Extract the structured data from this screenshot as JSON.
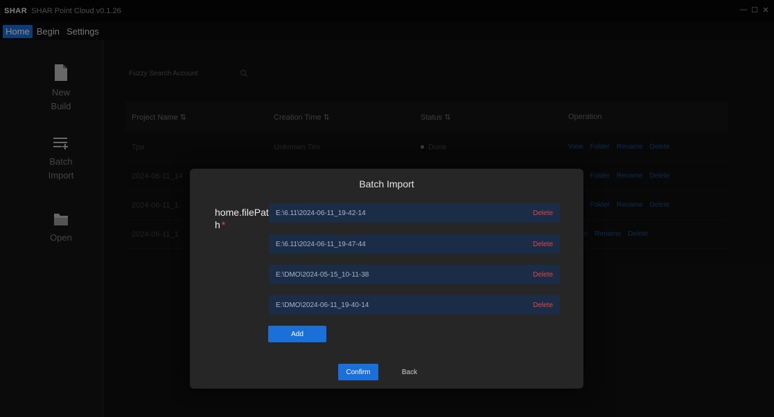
{
  "titlebar": {
    "logo": "SHAR",
    "title": "SHAR Point Cloud v0.1.26",
    "controls": [
      "—",
      "☐",
      "✕"
    ]
  },
  "menu": {
    "items": [
      "Home",
      "Begin",
      "Settings"
    ]
  },
  "sidebar": {
    "items": [
      {
        "label_line1": "New",
        "label_line2": "Build",
        "icon": "new-file-icon"
      },
      {
        "label_line1": "Batch",
        "label_line2": "Import",
        "icon": "list-add-icon"
      },
      {
        "label_line1": "Open",
        "label_line2": "",
        "icon": "folder-icon"
      }
    ]
  },
  "main": {
    "search_placeholder": "Fuzzy Search Account",
    "columns": [
      "Project Name ⇅",
      "Creation Time ⇅",
      "Status ⇅",
      "Operation"
    ],
    "rows": [
      {
        "name": "Три",
        "time": "Unknown Tim",
        "status": "Done"
      },
      {
        "name": "2024-06-11_14",
        "time": "",
        "status": ""
      },
      {
        "name": "2024-06-11_1",
        "time": "",
        "status": ""
      },
      {
        "name": "2024-06-11_1",
        "time": "",
        "status": ""
      }
    ],
    "operations": [
      "View",
      "Folder",
      "Rename",
      "Delete"
    ]
  },
  "modal": {
    "title": "Batch Import",
    "field_label": "home.filePath",
    "required_mark": "*",
    "paths": [
      "E:\\6.11\\2024-06-11_19-42-14",
      "E:\\6.11\\2024-06-11_19-47-44",
      "E:\\DMO\\2024-05-15_10-11-38",
      "E:\\DMO\\2024-06-11_19-40-14"
    ],
    "delete_label": "Delete",
    "add_label": "Add",
    "confirm_label": "Confirm",
    "back_label": "Back"
  },
  "colors": {
    "accent": "#1b6fd8",
    "danger": "#e04848",
    "modal_bg": "#262626",
    "path_bg": "#1b2c47"
  }
}
